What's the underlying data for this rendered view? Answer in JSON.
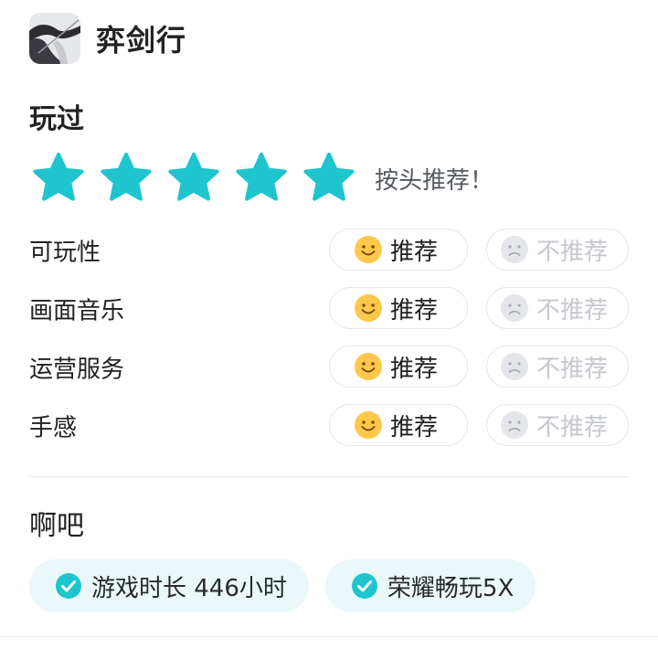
{
  "game": {
    "title": "弈剑行",
    "icon": "game-cover-icon"
  },
  "played_label": "玩过",
  "rating": {
    "stars_filled": 5,
    "stars_total": 5,
    "text": "按头推荐！",
    "star_color": "#1ec5cf"
  },
  "aspects": [
    {
      "label": "可玩性",
      "recommend_label": "推荐",
      "not_recommend_label": "不推荐",
      "selected": "recommend"
    },
    {
      "label": "画面音乐",
      "recommend_label": "推荐",
      "not_recommend_label": "不推荐",
      "selected": "recommend"
    },
    {
      "label": "运营服务",
      "recommend_label": "推荐",
      "not_recommend_label": "不推荐",
      "selected": "recommend"
    },
    {
      "label": "手感",
      "recommend_label": "推荐",
      "not_recommend_label": "不推荐",
      "selected": "recommend"
    }
  ],
  "review_text": "啊吧",
  "tags": [
    {
      "text": "游戏时长 446小时",
      "icon": "check-circle-icon"
    },
    {
      "text": "荣耀畅玩5X",
      "icon": "check-circle-icon"
    }
  ],
  "colors": {
    "accent": "#1ec5cf",
    "tag_bg": "#ebf8fa",
    "smile_face": "#ffc84a",
    "sad_face": "#e4e6ea"
  }
}
